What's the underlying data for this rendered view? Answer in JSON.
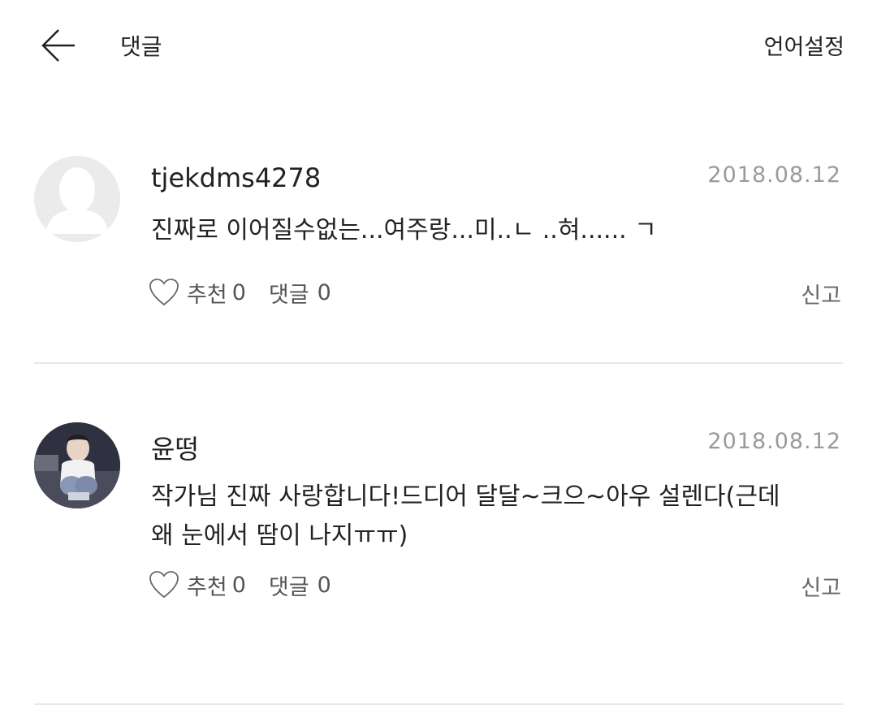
{
  "header": {
    "title": "댓글",
    "language_button": "언어설정",
    "back_icon": "arrow-left-icon"
  },
  "comments": [
    {
      "username": "tjekdms4278",
      "date": "2018.08.12",
      "text": "진짜로 이어질수없는...여주랑...미..ㄴ ..혀...... ㄱ",
      "avatar": "default-user-avatar",
      "like_label": "추천",
      "like_count": "0",
      "reply_label": "댓글",
      "reply_count": "0",
      "report_label": "신고"
    },
    {
      "username": "윤떵",
      "date": "2018.08.12",
      "text": "작가님 진짜 사랑합니다!드디어 달달~크으~아우 설렌다(근데\n왜 눈에서 땀이 나지ㅠㅠ)",
      "avatar": "user-photo-avatar",
      "like_label": "추천",
      "like_count": "0",
      "reply_label": "댓글",
      "reply_count": "0",
      "report_label": "신고"
    }
  ]
}
